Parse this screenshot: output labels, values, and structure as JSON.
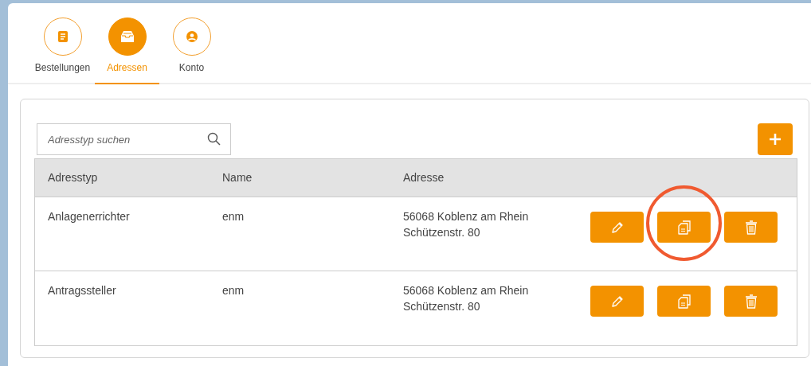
{
  "tabs": [
    {
      "label": "Bestellungen",
      "kind": "orders",
      "selected": false
    },
    {
      "label": "Adressen",
      "kind": "addresses",
      "selected": true
    },
    {
      "label": "Konto",
      "kind": "account",
      "selected": false
    }
  ],
  "search": {
    "placeholder": "Adresstyp suchen"
  },
  "table": {
    "columns": [
      "Adresstyp",
      "Name",
      "Adresse"
    ],
    "rows": [
      {
        "type": "Anlagenerrichter",
        "name": "enm",
        "address": [
          "56068 Koblenz am Rhein",
          "Schützenstr. 80"
        ],
        "copy_highlighted": true
      },
      {
        "type": "Antragssteller",
        "name": "enm",
        "address": [
          "56068 Koblenz am Rhein",
          "Schützenstr. 80"
        ],
        "copy_highlighted": false
      }
    ]
  }
}
